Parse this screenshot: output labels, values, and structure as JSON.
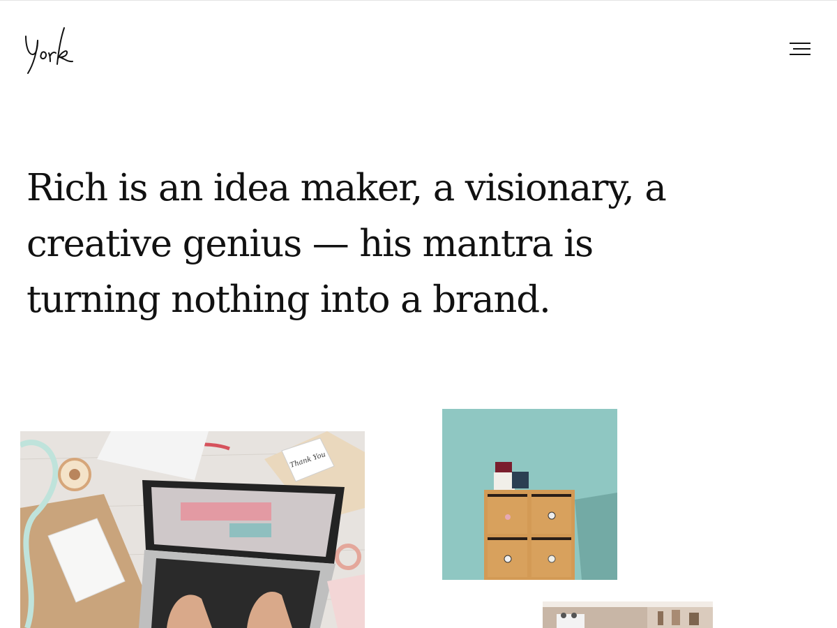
{
  "header": {
    "logo_text": "York",
    "menu_icon": "hamburger-menu-icon"
  },
  "hero": {
    "headline": "Rich is an idea maker, a visionary, a creative genius — his mantra is turning nothing into a brand."
  },
  "gallery": {
    "items": [
      {
        "subject": "laptop-desk-photo",
        "note_text": "Thank You"
      },
      {
        "subject": "wooden-cabinet-photo"
      },
      {
        "subject": "kitchen-shelf-photo"
      }
    ]
  },
  "colors": {
    "text": "#111111",
    "background": "#ffffff",
    "cabinet_wall": "#8fc7c2",
    "wood": "#d39a55"
  }
}
